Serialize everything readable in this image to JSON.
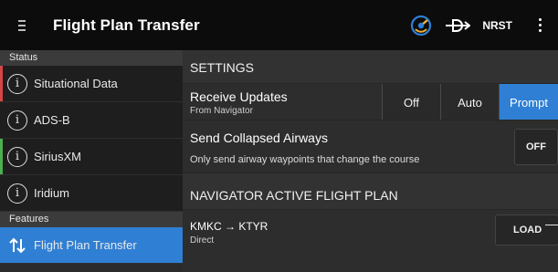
{
  "app": {
    "title": "Flight Plan Transfer",
    "nrst_label": "NRST",
    "icons": {
      "menu": "hamburger-icon",
      "status": "connectivity-status-icon",
      "route": "direct-to-icon",
      "more": "more-vertical-icon"
    }
  },
  "sidebar": {
    "status_header": "Status",
    "status_items": [
      {
        "label": "Situational Data",
        "stripe": "#d64545"
      },
      {
        "label": "ADS-B",
        "stripe": ""
      },
      {
        "label": "SiriusXM",
        "stripe": "#4caf50"
      },
      {
        "label": "Iridium",
        "stripe": ""
      }
    ],
    "features_header": "Features",
    "features_items": [
      {
        "label": "Flight Plan Transfer",
        "active": true
      }
    ]
  },
  "settings": {
    "header": "SETTINGS",
    "receive_updates": {
      "title": "Receive Updates",
      "subtitle": "From Navigator",
      "options": [
        "Off",
        "Auto",
        "Prompt"
      ],
      "selected": "Prompt"
    },
    "collapsed_airways": {
      "title": "Send Collapsed Airways",
      "subtitle": "Only send airway waypoints that change the course",
      "toggle_label": "OFF"
    }
  },
  "navigator": {
    "header": "NAVIGATOR ACTIVE FLIGHT PLAN",
    "route": "KMKC → KTYR",
    "subtitle": "Direct",
    "load_label": "LOAD"
  },
  "colors": {
    "accent": "#2f7fd4",
    "topbar": "#0c0c0c",
    "alert_red": "#d64545",
    "ok_green": "#4caf50"
  }
}
